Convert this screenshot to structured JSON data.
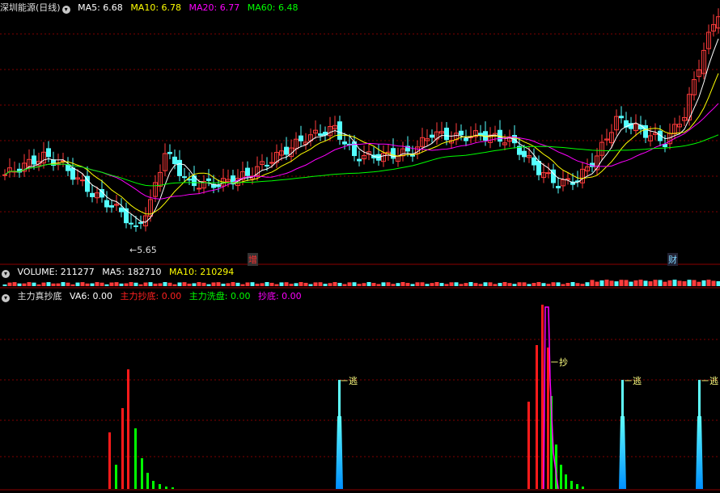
{
  "main_panel": {
    "stock_name": "深圳能源",
    "period": "(日线)",
    "ma_legend": [
      {
        "label": "MA5: 6.68",
        "color": "#ffffff"
      },
      {
        "label": "MA10: 6.78",
        "color": "#ffff00"
      },
      {
        "label": "MA20: 6.77",
        "color": "#ff00ff"
      },
      {
        "label": "MA60: 6.48",
        "color": "#00ff00"
      }
    ],
    "low_marker": "5.65",
    "marker_zeng": "增",
    "marker_cai": "财"
  },
  "volume_panel": {
    "legend": [
      {
        "label": "VOLUME: 211277",
        "color": "#ffffff"
      },
      {
        "label": "MA5: 182710",
        "color": "#ffffff"
      },
      {
        "label": "MA10: 210294",
        "color": "#ffff00"
      }
    ]
  },
  "indicator_panel": {
    "name": "主力真抄底",
    "legend": [
      {
        "label": "VA6: 0.00",
        "color": "#ffffff"
      },
      {
        "label": "主力抄底: 0.00",
        "color": "#ff2020"
      },
      {
        "label": "主力洗盘: 0.00",
        "color": "#00ff00"
      },
      {
        "label": "抄底: 0.00",
        "color": "#ff00ff"
      }
    ],
    "signal_escape": "逃",
    "signal_bottom": "抄"
  },
  "colors": {
    "up": "#ff3b3b",
    "down": "#54ffff",
    "ma5": "#ffffff",
    "ma10": "#ffff00",
    "ma20": "#ff00ff",
    "ma60": "#00ff00"
  }
}
